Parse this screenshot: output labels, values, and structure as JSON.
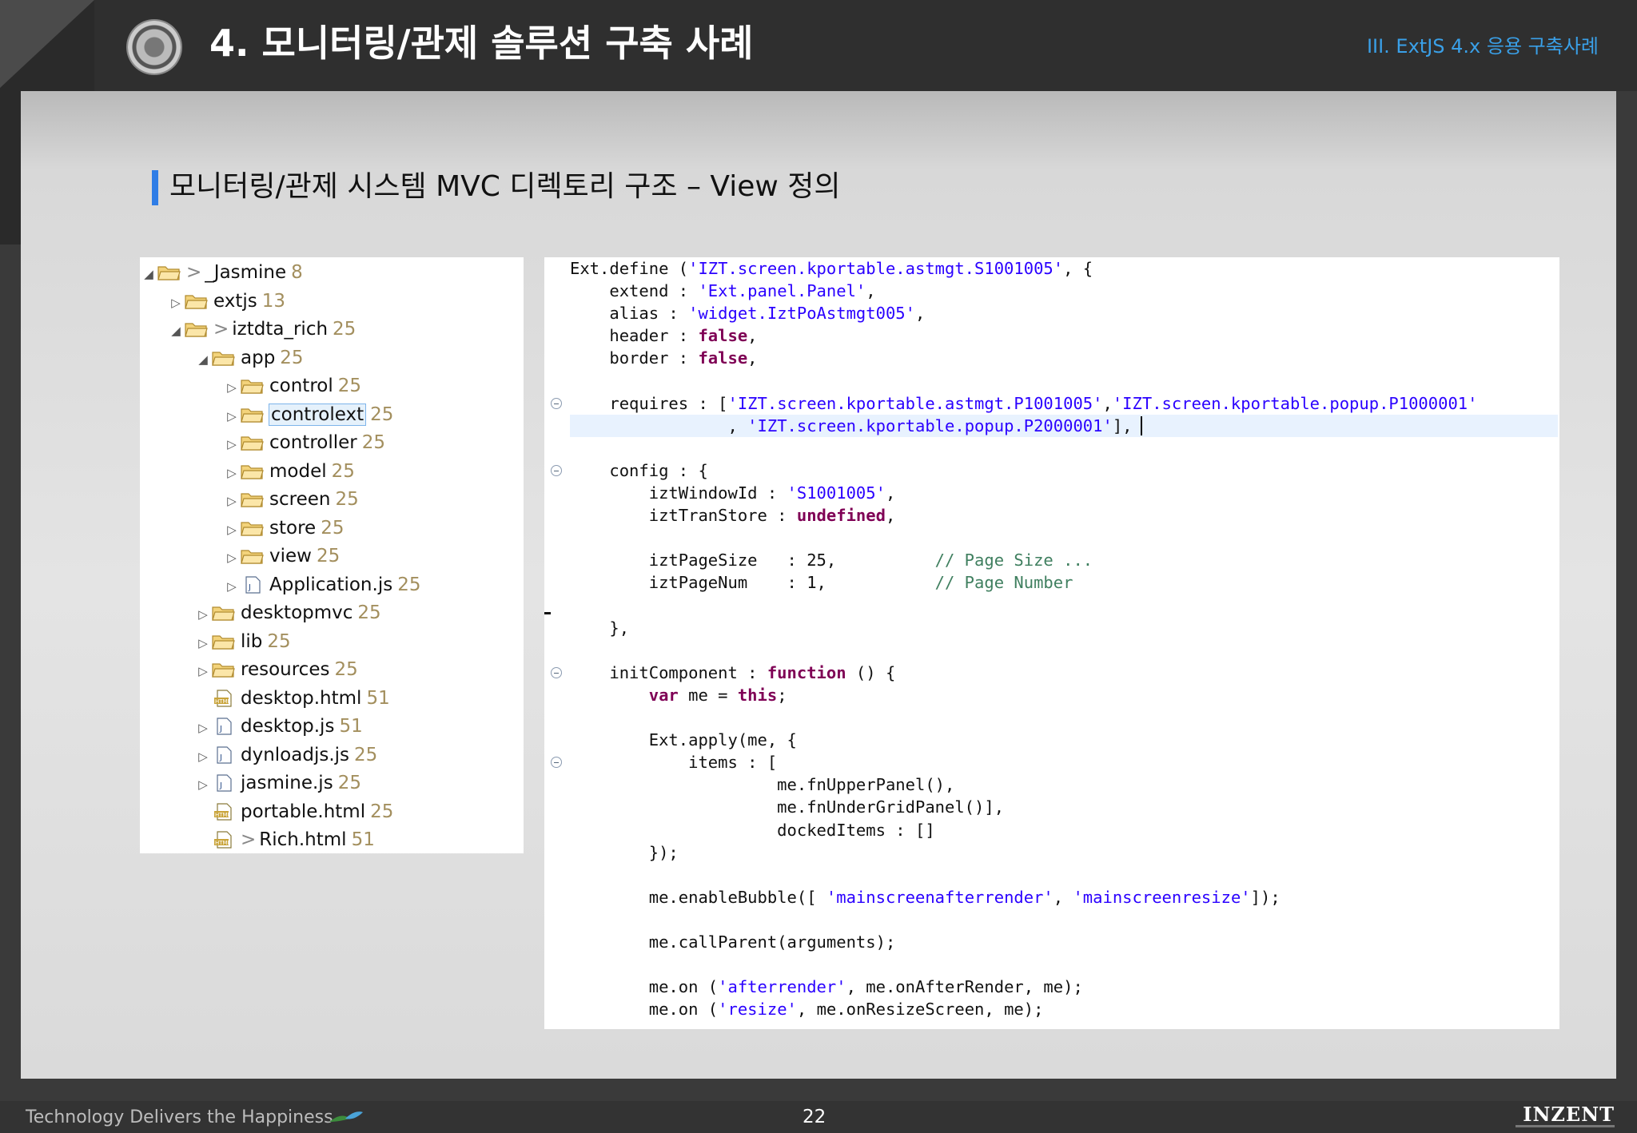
{
  "header": {
    "title": "4. 모니터링/관제 솔루션 구축 사례",
    "section": "III. ExtJS 4.x 응용 구축사례"
  },
  "subtitle": "모니터링/관제 시스템  MVC  디렉토리 구조  –  View 정의",
  "tree": {
    "items": [
      {
        "toggle": "◢",
        "icon": "folder",
        "dec": ">",
        "name": "_Jasmine",
        "count": "8"
      },
      {
        "toggle": "▷",
        "icon": "folder",
        "dec": "",
        "name": "extjs",
        "count": "13"
      },
      {
        "toggle": "◢",
        "icon": "folder",
        "dec": ">",
        "name": "iztdta_rich",
        "count": "25"
      },
      {
        "toggle": "◢",
        "icon": "folder",
        "dec": "",
        "name": "app",
        "count": "25"
      },
      {
        "toggle": "▷",
        "icon": "folder",
        "dec": "",
        "name": "control",
        "count": "25"
      },
      {
        "toggle": "▷",
        "icon": "folder",
        "dec": "",
        "name": "controlext",
        "count": "25"
      },
      {
        "toggle": "▷",
        "icon": "folder",
        "dec": "",
        "name": "controller",
        "count": "25"
      },
      {
        "toggle": "▷",
        "icon": "folder",
        "dec": "",
        "name": "model",
        "count": "25"
      },
      {
        "toggle": "▷",
        "icon": "folder",
        "dec": "",
        "name": "screen",
        "count": "25"
      },
      {
        "toggle": "▷",
        "icon": "folder",
        "dec": "",
        "name": "store",
        "count": "25"
      },
      {
        "toggle": "▷",
        "icon": "folder",
        "dec": "",
        "name": "view",
        "count": "25"
      },
      {
        "toggle": "▷",
        "icon": "js-file",
        "dec": "",
        "name": "Application.js",
        "count": "25"
      },
      {
        "toggle": "▷",
        "icon": "folder",
        "dec": "",
        "name": "desktopmvc",
        "count": "25"
      },
      {
        "toggle": "▷",
        "icon": "folder",
        "dec": "",
        "name": "lib",
        "count": "25"
      },
      {
        "toggle": "▷",
        "icon": "folder",
        "dec": "",
        "name": "resources",
        "count": "25"
      },
      {
        "toggle": "",
        "icon": "html-file",
        "dec": "",
        "name": "desktop.html",
        "count": "51"
      },
      {
        "toggle": "▷",
        "icon": "js-file",
        "dec": "",
        "name": "desktop.js",
        "count": "51"
      },
      {
        "toggle": "▷",
        "icon": "js-file",
        "dec": "",
        "name": "dynloadjs.js",
        "count": "25"
      },
      {
        "toggle": "▷",
        "icon": "js-file",
        "dec": "",
        "name": "jasmine.js",
        "count": "25"
      },
      {
        "toggle": "",
        "icon": "html-file",
        "dec": "",
        "name": "portable.html",
        "count": "25"
      },
      {
        "toggle": "",
        "icon": "html-file",
        "dec": ">",
        "name": "Rich.html",
        "count": "51"
      }
    ]
  },
  "code": {
    "lines": [
      [
        [
          "t",
          "Ext.define ("
        ],
        [
          "s",
          "'IZT.screen.kportable.astmgt.S1001005'"
        ],
        [
          "t",
          ", {"
        ]
      ],
      [
        [
          "t",
          "    extend : "
        ],
        [
          "s",
          "'Ext.panel.Panel'"
        ],
        [
          "t",
          ","
        ]
      ],
      [
        [
          "t",
          "    alias : "
        ],
        [
          "s",
          "'widget.IztPoAstmgt005'"
        ],
        [
          "t",
          ","
        ]
      ],
      [
        [
          "t",
          "    header : "
        ],
        [
          "k",
          "false"
        ],
        [
          "t",
          ","
        ]
      ],
      [
        [
          "t",
          "    border : "
        ],
        [
          "k",
          "false"
        ],
        [
          "t",
          ","
        ]
      ],
      [],
      [
        [
          "t",
          "    requires : ["
        ],
        [
          "s",
          "'IZT.screen.kportable.astmgt.P1001005'"
        ],
        [
          "t",
          ","
        ],
        [
          "s",
          "'IZT.screen.kportable.popup.P1000001'"
        ]
      ],
      [
        [
          "t",
          "                , "
        ],
        [
          "s",
          "'IZT.screen.kportable.popup.P2000001'"
        ],
        [
          "t",
          "],"
        ]
      ],
      [],
      [
        [
          "t",
          "    config : {"
        ]
      ],
      [
        [
          "t",
          "        iztWindowId : "
        ],
        [
          "s",
          "'S1001005'"
        ],
        [
          "t",
          ","
        ]
      ],
      [
        [
          "t",
          "        iztTranStore : "
        ],
        [
          "k",
          "undefined"
        ],
        [
          "t",
          ","
        ]
      ],
      [],
      [
        [
          "t",
          "        iztPageSize   : 25,          "
        ],
        [
          "c",
          "// Page Size ..."
        ]
      ],
      [
        [
          "t",
          "        iztPageNum    : 1,           "
        ],
        [
          "c",
          "// Page Number"
        ]
      ],
      [],
      [
        [
          "t",
          "    },"
        ]
      ],
      [],
      [
        [
          "t",
          "    initComponent : "
        ],
        [
          "k",
          "function"
        ],
        [
          "t",
          " () {"
        ]
      ],
      [
        [
          "t",
          "        "
        ],
        [
          "k",
          "var"
        ],
        [
          "t",
          " me = "
        ],
        [
          "k",
          "this"
        ],
        [
          "t",
          ";"
        ]
      ],
      [],
      [
        [
          "t",
          "        Ext.apply(me, {"
        ]
      ],
      [
        [
          "t",
          "            items : ["
        ]
      ],
      [
        [
          "t",
          "                     me.fnUpperPanel(),"
        ]
      ],
      [
        [
          "t",
          "                     me.fnUnderGridPanel()],"
        ]
      ],
      [
        [
          "t",
          "                     dockedItems : []"
        ]
      ],
      [
        [
          "t",
          "        });"
        ]
      ],
      [],
      [
        [
          "t",
          "        me.enableBubble([ "
        ],
        [
          "s",
          "'mainscreenafterrender'"
        ],
        [
          "t",
          ", "
        ],
        [
          "s",
          "'mainscreenresize'"
        ],
        [
          "t",
          "]);"
        ]
      ],
      [],
      [
        [
          "t",
          "        me.callParent(arguments);"
        ]
      ],
      [],
      [
        [
          "t",
          "        me.on ("
        ],
        [
          "s",
          "'afterrender'"
        ],
        [
          "t",
          ", me.onAfterRender, me);"
        ]
      ],
      [
        [
          "t",
          "        me.on ("
        ],
        [
          "s",
          "'resize'"
        ],
        [
          "t",
          ", me.onResizeScreen, me);"
        ]
      ]
    ]
  },
  "footer": {
    "tagline": "Technology Delivers the Happiness",
    "page": "22",
    "brand": "INZENT"
  }
}
